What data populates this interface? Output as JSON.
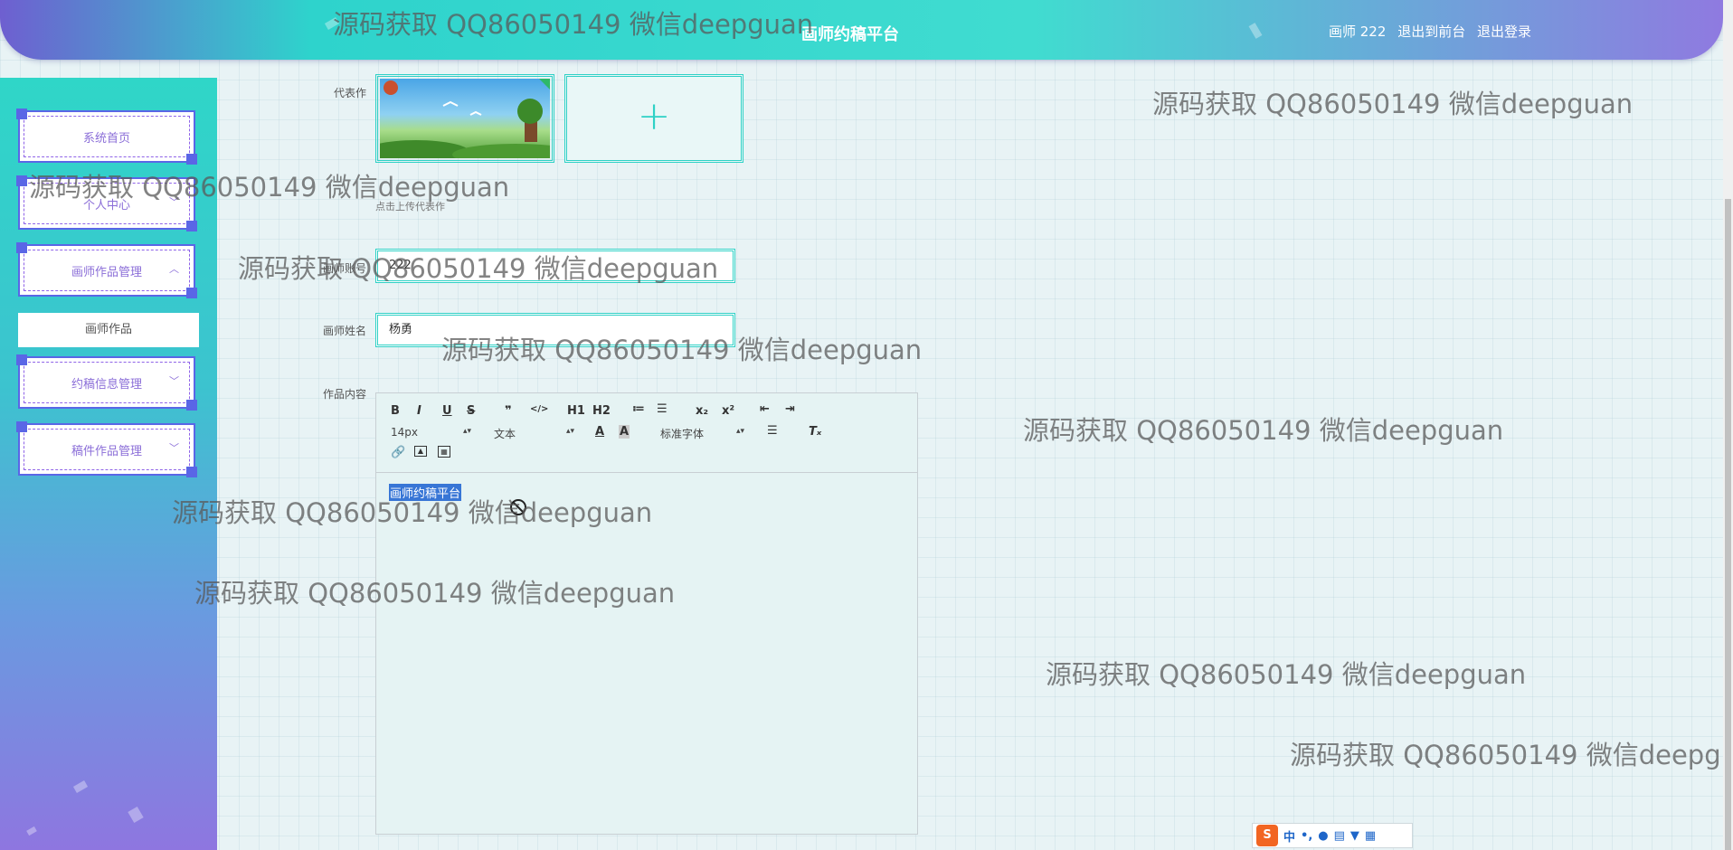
{
  "header": {
    "title": "画师约稿平台",
    "user_label": "画师 222",
    "back_to_front": "退出到前台",
    "logout": "退出登录"
  },
  "sidebar": {
    "items": [
      {
        "label": "系统首页",
        "chevron": ""
      },
      {
        "label": "个人中心",
        "chevron": "﹀"
      },
      {
        "label": "画师作品管理",
        "chevron": "︿"
      },
      {
        "label": "约稿信息管理",
        "chevron": "﹀"
      },
      {
        "label": "稿件作品管理",
        "chevron": "﹀"
      }
    ],
    "sub_item": "画师作品"
  },
  "form": {
    "representative_work_label": "代表作",
    "upload_hint": "点击上传代表作",
    "account_label": "画师账号",
    "account_value": "222",
    "name_label": "画师姓名",
    "name_value": "杨勇",
    "content_label": "作品内容",
    "editor_content": "画师约稿平台"
  },
  "editor_toolbar": {
    "font_size": "14px",
    "text_type": "文本",
    "font_family": "标准字体",
    "buttons_row1": [
      "B",
      "I",
      "U",
      "S",
      "❞",
      "</>",
      "H1",
      "H2",
      "≔",
      "☰",
      "x₂",
      "x²",
      "⇤",
      "⇥"
    ],
    "buttons_row3": [
      "link-icon",
      "image-icon",
      "video-icon"
    ]
  },
  "watermark": "源码获取 QQ86050149 微信deepguan",
  "ime": {
    "logo": "S",
    "mode": "中"
  }
}
